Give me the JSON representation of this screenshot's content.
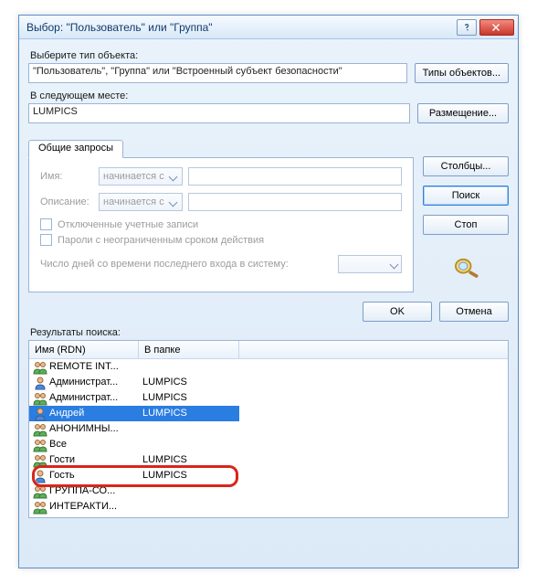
{
  "title": "Выбор: \"Пользователь\" или \"Группа\"",
  "objtype": {
    "label": "Выберите тип объекта:",
    "value": "\"Пользователь\", \"Группа\" или \"Встроенный субъект безопасности\"",
    "btn": "Типы объектов..."
  },
  "loc": {
    "label": "В следующем месте:",
    "value": "LUMPICS",
    "btn": "Размещение..."
  },
  "tab": "Общие запросы",
  "q": {
    "name_label": "Имя:",
    "desc_label": "Описание:",
    "starts": "начинается с",
    "chk1": "Отключенные учетные записи",
    "chk2": "Пароли с неограниченным сроком действия",
    "days_label": "Число дней со времени последнего входа в систему:"
  },
  "side": {
    "cols": "Столбцы...",
    "find": "Поиск",
    "stop": "Стоп"
  },
  "okcancel": {
    "ok": "OK",
    "cancel": "Отмена"
  },
  "res": {
    "label": "Результаты поиска:",
    "col1": "Имя (RDN)",
    "col2": "В папке",
    "rows": [
      {
        "icon": "group",
        "name": "REMOTE INT...",
        "folder": ""
      },
      {
        "icon": "user",
        "name": "Администрат...",
        "folder": "LUMPICS"
      },
      {
        "icon": "group",
        "name": "Администрат...",
        "folder": "LUMPICS"
      },
      {
        "icon": "user",
        "name": "Андрей",
        "folder": "LUMPICS",
        "selected": true
      },
      {
        "icon": "group",
        "name": "АНОНИМНЫ...",
        "folder": ""
      },
      {
        "icon": "group",
        "name": "Все",
        "folder": ""
      },
      {
        "icon": "group",
        "name": "Гости",
        "folder": "LUMPICS"
      },
      {
        "icon": "user",
        "name": "Гость",
        "folder": "LUMPICS"
      },
      {
        "icon": "group",
        "name": "ГРУППА-СО...",
        "folder": ""
      },
      {
        "icon": "group",
        "name": "ИНТЕРАКТИ...",
        "folder": ""
      }
    ]
  }
}
